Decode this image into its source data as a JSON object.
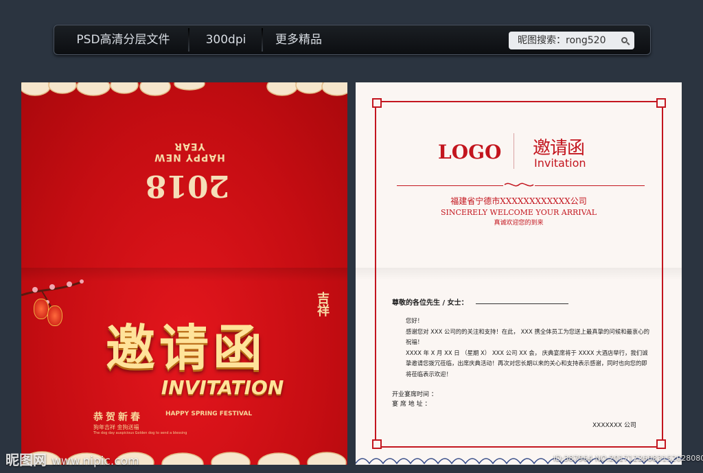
{
  "toolbar": {
    "item1": "PSD高清分层文件",
    "item2": "300dpi",
    "item3": "更多精品",
    "search_text": "昵图搜索：rong520"
  },
  "cover": {
    "happy_new_year": "HAPPY NEW YEAR",
    "year": "2018",
    "ji_xiang": "吉祥",
    "title": "邀请函",
    "invitation": "INVITATION",
    "gong_he_xin_chun": "恭贺新春",
    "happy_spring": "HAPPY SPRING FESTIVAL",
    "line1": "狗年吉祥   金狗送福",
    "line2": "The dog day auspicious Golden dog to send a blessing"
  },
  "inner": {
    "logo": "LOGO",
    "yao_qing_han": "邀请函",
    "invitation_en": "Invitation",
    "company": "福建省宁德市XXXXXXXXXXXX公司",
    "welcome_en": "SINCERELY WELCOME YOUR ARRIVAL",
    "welcome_cn": "真诚欢迎您的到来",
    "greeting": "尊敬的各位先生 / 女士：",
    "hello": "您好！",
    "para1": "感谢您对 XXX 公司的的关注和支持！在此， XXX 携全体员工为您送上最真挚的问候和最衷心的祝福！",
    "para2": "XXXX 年 X 月 XX 日 （星期 X） XXX 公司 XX 会， 庆典宴席将于 XXXX 大酒店举行，我们诚挚邀请您拨冗莅临，出席庆典活动！再次对您长期以来的关心和支持表示感谢，同时也向您的即将莅临表示欢迎！",
    "time_label": "开业宴席时间 ：",
    "address_label": "宴 席 地 址 ：",
    "signature": "XXXXXXX 公司"
  },
  "watermark": {
    "brand": "昵图网",
    "site": "www.nipic.com",
    "id_text": "ID:387964 NO:20171226083152028080"
  },
  "colors": {
    "cover_red": "#c50d12",
    "gold": "#ffe39a",
    "frame_red": "#c3151e",
    "background": "#2b3440"
  }
}
